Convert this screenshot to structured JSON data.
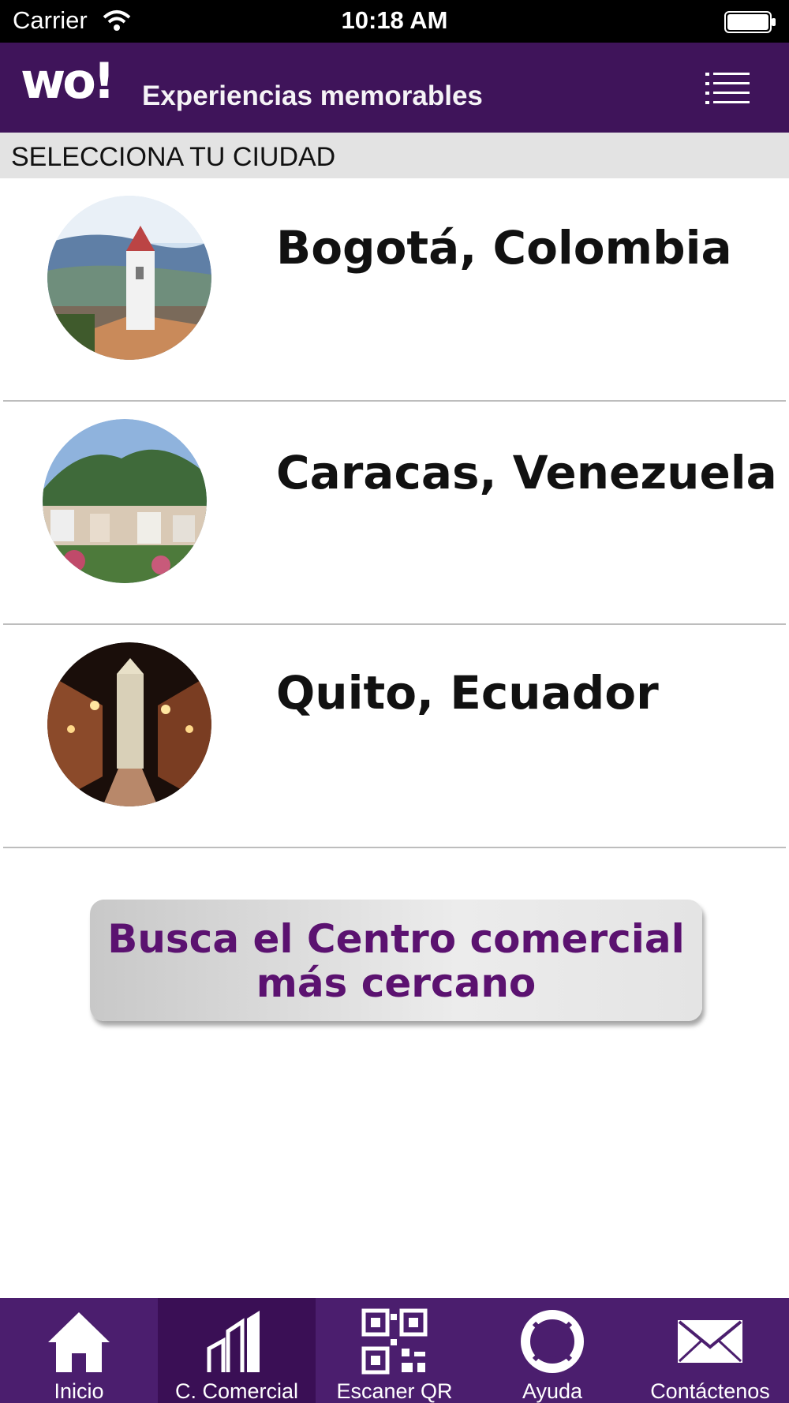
{
  "status_bar": {
    "carrier": "Carrier",
    "time": "10:18 AM"
  },
  "header": {
    "logo_text": "wo!",
    "tagline": "Experiencias memorables",
    "menu_icon": "list-menu-icon"
  },
  "section": {
    "title": "SELECCIONA TU CIUDAD"
  },
  "cities": [
    {
      "name": "Bogotá, Colombia",
      "image": "bogota-church-photo"
    },
    {
      "name": "Caracas, Venezuela",
      "image": "caracas-mountain-photo"
    },
    {
      "name": "Quito, Ecuador",
      "image": "quito-night-street-photo"
    }
  ],
  "find_button": {
    "line1": "Busca el Centro comercial",
    "line2": "más cercano"
  },
  "tabs": [
    {
      "label": "Inicio",
      "icon": "home-icon",
      "active": false
    },
    {
      "label": "C. Comercial",
      "icon": "building-icon",
      "active": true
    },
    {
      "label": "Escaner QR",
      "icon": "qr-code-icon",
      "active": false
    },
    {
      "label": "Ayuda",
      "icon": "lifebuoy-icon",
      "active": false
    },
    {
      "label": "Contáctenos",
      "icon": "envelope-icon",
      "active": false
    }
  ],
  "colors": {
    "brand_purple": "#3f145a",
    "tab_bar": "#4b1e6e",
    "button_text": "#5b1270"
  }
}
